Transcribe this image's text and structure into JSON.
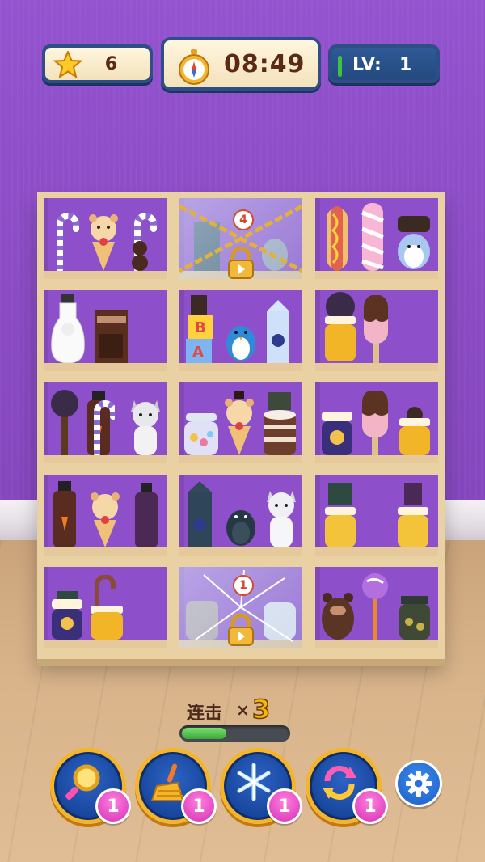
{
  "hud": {
    "stars": "6",
    "timer": "08:49",
    "level_label": "LV:",
    "level_value": "1"
  },
  "locks": [
    {
      "count": "4"
    },
    {
      "count": "1"
    }
  ],
  "combo": {
    "label": "连击",
    "times": "×",
    "value": "3",
    "progress": 0.42
  },
  "powerups": [
    {
      "name": "magnifier",
      "count": "1"
    },
    {
      "name": "broom",
      "count": "1"
    },
    {
      "name": "snowflake",
      "count": "1"
    },
    {
      "name": "shuffle",
      "count": "1"
    }
  ],
  "colors": {
    "wall": "#8e4fca",
    "accent_gold": "#f5b52b",
    "button_blue": "#1d4fa8",
    "badge_pink": "#e040c0"
  },
  "icons": {
    "settings": "gear-icon"
  }
}
